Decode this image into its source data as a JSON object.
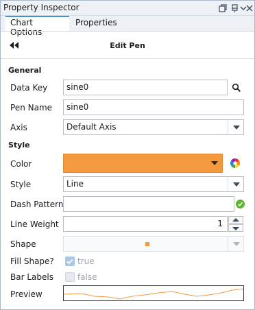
{
  "window": {
    "title": "Property Inspector",
    "icons": [
      "restore-icon",
      "pin-icon",
      "dropdown-menu-icon",
      "close-icon"
    ]
  },
  "tabs": [
    {
      "label": "Chart Options",
      "active": true
    },
    {
      "label": "Properties",
      "active": false
    }
  ],
  "header": {
    "back_icon": "double-chevron-left-icon",
    "title": "Edit Pen"
  },
  "sections": {
    "general": "General",
    "style": "Style"
  },
  "general": {
    "data_key": {
      "label": "Data Key",
      "value": "sine0",
      "icon": "search-icon"
    },
    "pen_name": {
      "label": "Pen Name",
      "value": "sine0"
    },
    "axis": {
      "label": "Axis",
      "value": "Default Axis"
    }
  },
  "style": {
    "color": {
      "label": "Color",
      "value": "#F5993F",
      "icon": "color-wheel-icon"
    },
    "style": {
      "label": "Style",
      "value": "Line"
    },
    "dash_pattern": {
      "label": "Dash Pattern",
      "value": "",
      "status_icon": "check-valid-icon"
    },
    "line_weight": {
      "label": "Line Weight",
      "value": "1"
    },
    "shape": {
      "label": "Shape",
      "value": "square-marker",
      "disabled": true
    },
    "fill_shape": {
      "label": "Fill Shape?",
      "checked": true,
      "text": "true",
      "disabled": true
    },
    "bar_labels": {
      "label": "Bar Labels",
      "checked": false,
      "text": "false",
      "disabled": true
    },
    "preview": {
      "label": "Preview",
      "line_color": "#F5993F"
    }
  },
  "colors": {
    "accent": "#4A90C8",
    "pen": "#F5993F",
    "valid": "#5CB531"
  }
}
